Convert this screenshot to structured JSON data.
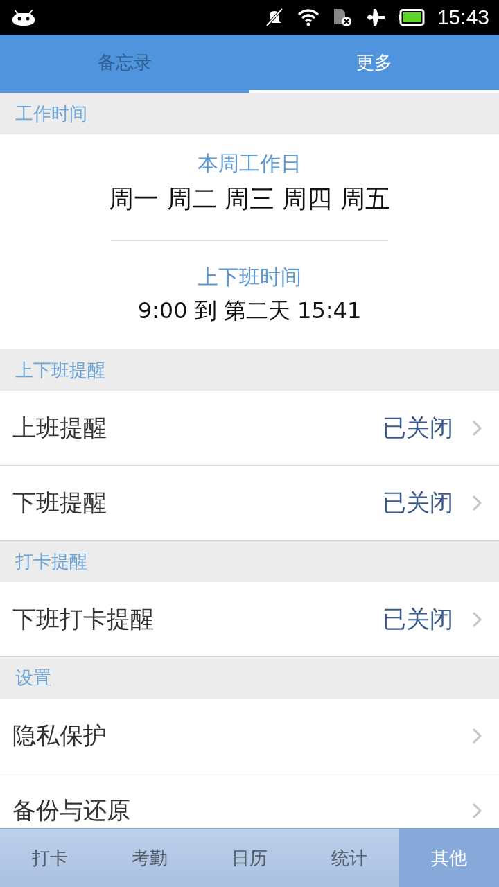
{
  "status_bar": {
    "time": "15:43"
  },
  "tabs": [
    {
      "label": "备忘录",
      "selected": false
    },
    {
      "label": "更多",
      "selected": true
    }
  ],
  "work_time": {
    "header": "工作时间",
    "workdays_label": "本周工作日",
    "workdays": "周一 周二 周三 周四 周五",
    "hours_label": "上下班时间",
    "hours": "9:00 到 第二天 15:41"
  },
  "sections": [
    {
      "header": "上下班提醒",
      "rows": [
        {
          "label": "上班提醒",
          "value": "已关闭"
        },
        {
          "label": "下班提醒",
          "value": "已关闭"
        }
      ]
    },
    {
      "header": "打卡提醒",
      "rows": [
        {
          "label": "下班打卡提醒",
          "value": "已关闭"
        }
      ]
    },
    {
      "header": "设置",
      "rows": [
        {
          "label": "隐私保护"
        },
        {
          "label": "备份与还原"
        }
      ]
    }
  ],
  "bottom_nav": [
    {
      "label": "打卡",
      "selected": false
    },
    {
      "label": "考勤",
      "selected": false
    },
    {
      "label": "日历",
      "selected": false
    },
    {
      "label": "统计",
      "selected": false
    },
    {
      "label": "其他",
      "selected": true
    }
  ]
}
